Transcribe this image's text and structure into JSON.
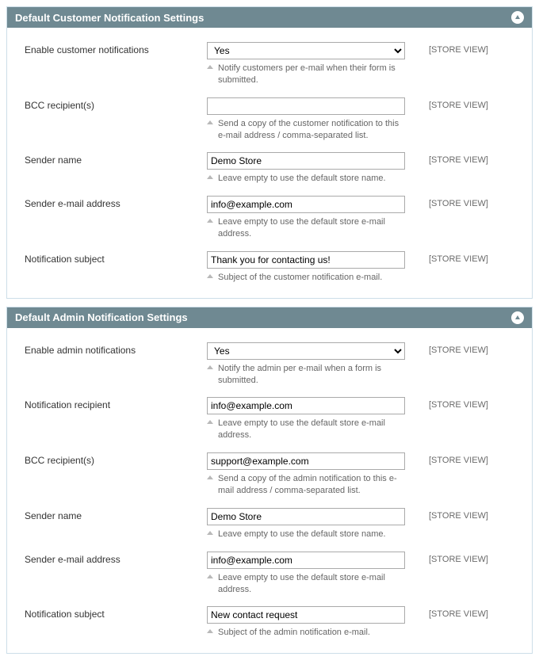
{
  "scope_label": "[STORE VIEW]",
  "sections": {
    "customer": {
      "title": "Default Customer Notification Settings",
      "fields": {
        "enable": {
          "label": "Enable customer notifications",
          "value": "Yes",
          "help": "Notify customers per e-mail when their form is submitted."
        },
        "bcc": {
          "label": "BCC recipient(s)",
          "value": "",
          "help": "Send a copy of the customer notification to this e-mail address / comma-separated list."
        },
        "sender_name": {
          "label": "Sender name",
          "value": "Demo Store",
          "help": "Leave empty to use the default store name."
        },
        "sender_email": {
          "label": "Sender e-mail address",
          "value": "info@example.com",
          "help": "Leave empty to use the default store e-mail address."
        },
        "subject": {
          "label": "Notification subject",
          "value": "Thank you for contacting us!",
          "help": "Subject of the customer notification e-mail."
        }
      }
    },
    "admin": {
      "title": "Default Admin Notification Settings",
      "fields": {
        "enable": {
          "label": "Enable admin notifications",
          "value": "Yes",
          "help": "Notify the admin per e-mail when a form is submitted."
        },
        "recipient": {
          "label": "Notification recipient",
          "value": "info@example.com",
          "help": "Leave empty to use the default store e-mail address."
        },
        "bcc": {
          "label": "BCC recipient(s)",
          "value": "support@example.com",
          "help": "Send a copy of the admin notification to this e-mail address / comma-separated list."
        },
        "sender_name": {
          "label": "Sender name",
          "value": "Demo Store",
          "help": "Leave empty to use the default store name."
        },
        "sender_email": {
          "label": "Sender e-mail address",
          "value": "info@example.com",
          "help": "Leave empty to use the default store e-mail address."
        },
        "subject": {
          "label": "Notification subject",
          "value": "New contact request",
          "help": "Subject of the admin notification e-mail."
        }
      }
    }
  }
}
